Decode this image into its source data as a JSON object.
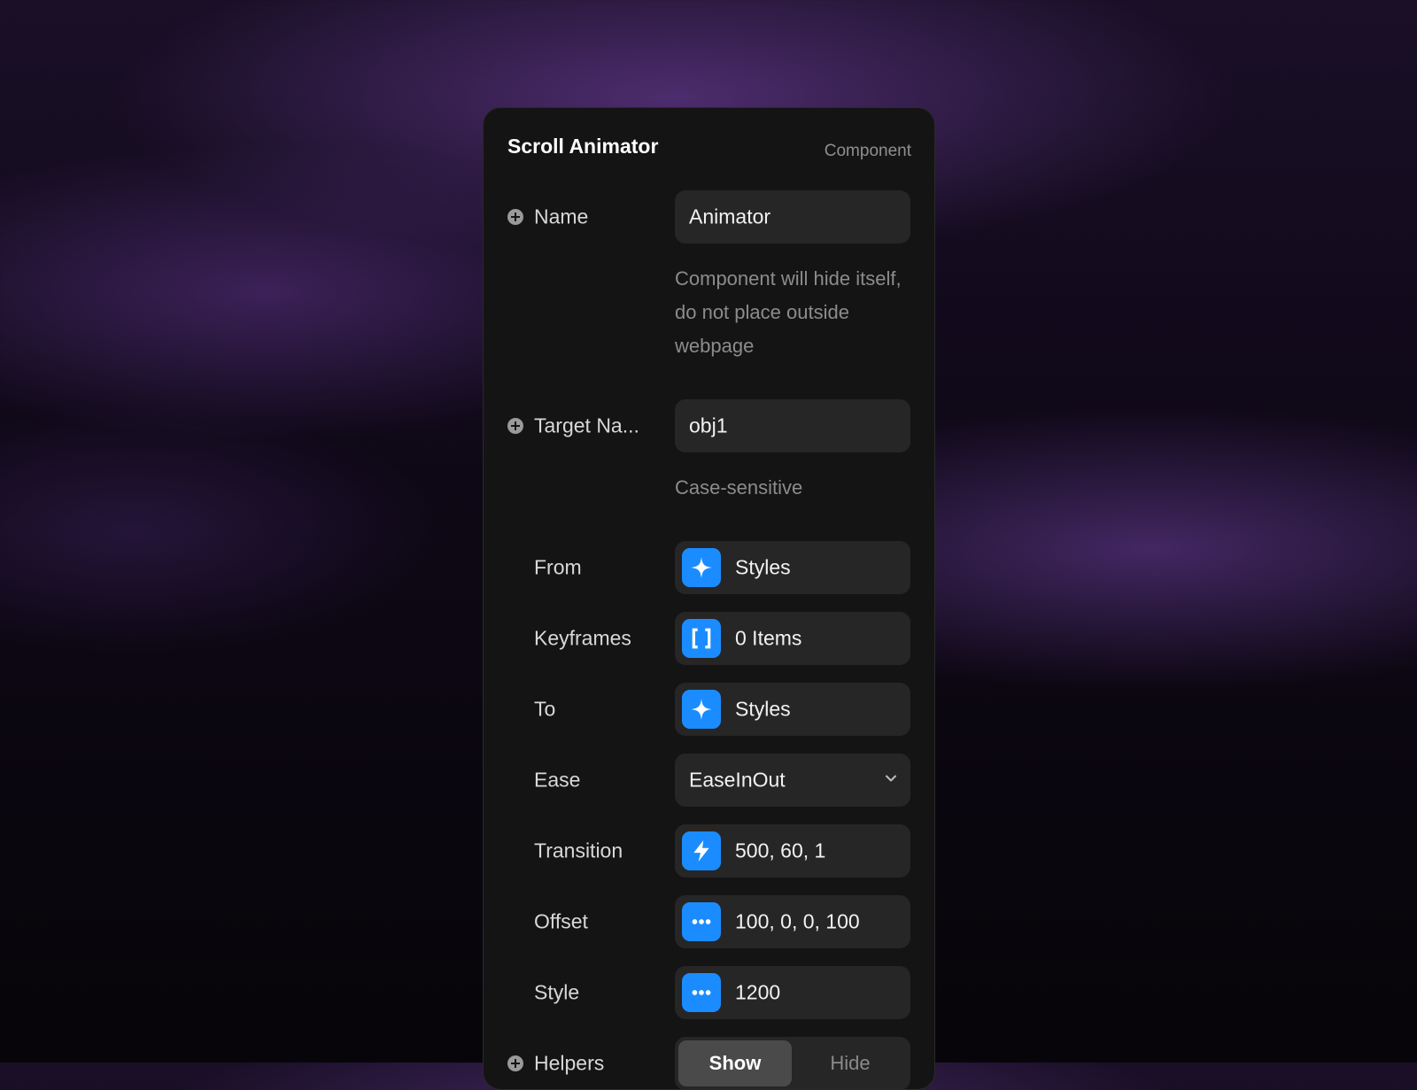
{
  "panel": {
    "title": "Scroll Animator",
    "type_label": "Component"
  },
  "fields": {
    "name": {
      "label": "Name",
      "value": "Animator",
      "hint": "Component will hide itself, do not place outside webpage"
    },
    "target_name": {
      "label": "Target Na...",
      "value": "obj1",
      "hint": "Case-sensitive"
    },
    "from": {
      "label": "From",
      "value": "Styles",
      "icon": "sparkle-icon"
    },
    "keyframes": {
      "label": "Keyframes",
      "value": "0 Items",
      "icon": "brackets-icon"
    },
    "to": {
      "label": "To",
      "value": "Styles",
      "icon": "sparkle-icon"
    },
    "ease": {
      "label": "Ease",
      "value": "EaseInOut",
      "icon": "chevron-down-icon"
    },
    "transition": {
      "label": "Transition",
      "value": "500, 60, 1",
      "icon": "lightning-icon"
    },
    "offset": {
      "label": "Offset",
      "value": "100, 0, 0, 100",
      "icon": "ellipsis-icon"
    },
    "style": {
      "label": "Style",
      "value": "1200",
      "icon": "ellipsis-icon"
    },
    "helpers": {
      "label": "Helpers",
      "options": [
        "Show",
        "Hide"
      ],
      "selected": "Show"
    }
  },
  "colors": {
    "accent": "#1a8cff",
    "panel_bg": "#141414",
    "field_bg": "#262626"
  }
}
